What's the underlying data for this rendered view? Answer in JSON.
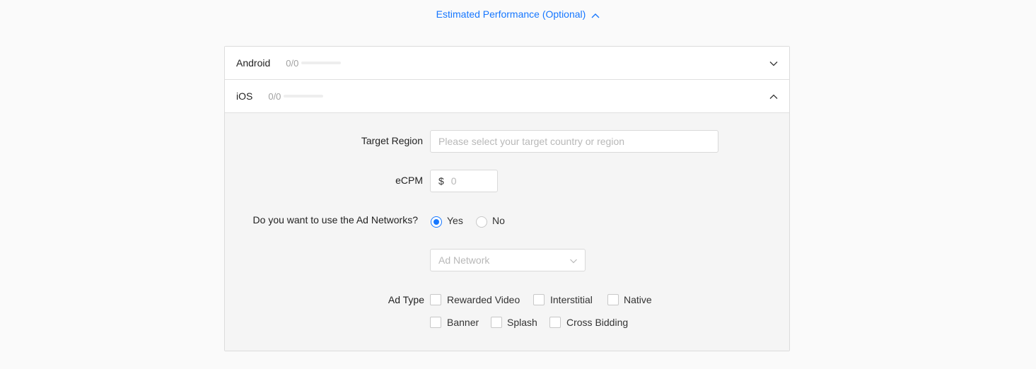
{
  "header": {
    "toggle_label": "Estimated Performance (Optional)"
  },
  "platforms": [
    {
      "name": "Android",
      "count": "0/0",
      "progress": 0,
      "expanded": false
    },
    {
      "name": "iOS",
      "count": "0/0",
      "progress": 0,
      "expanded": true
    }
  ],
  "form": {
    "target_region": {
      "label": "Target Region",
      "placeholder": "Please select your target country or region",
      "value": ""
    },
    "ecpm": {
      "label": "eCPM",
      "prefix": "$",
      "placeholder": "0",
      "value": ""
    },
    "ad_networks": {
      "label": "Do you want to use the Ad Networks?",
      "options": [
        "Yes",
        "No"
      ],
      "selected": "Yes"
    },
    "ad_network_select": {
      "placeholder": "Ad Network"
    },
    "ad_type": {
      "label": "Ad Type",
      "options": [
        "Rewarded Video",
        "Interstitial",
        "Native",
        "Banner",
        "Splash",
        "Cross Bidding"
      ],
      "checked": []
    }
  },
  "colors": {
    "accent": "#1677ff"
  }
}
